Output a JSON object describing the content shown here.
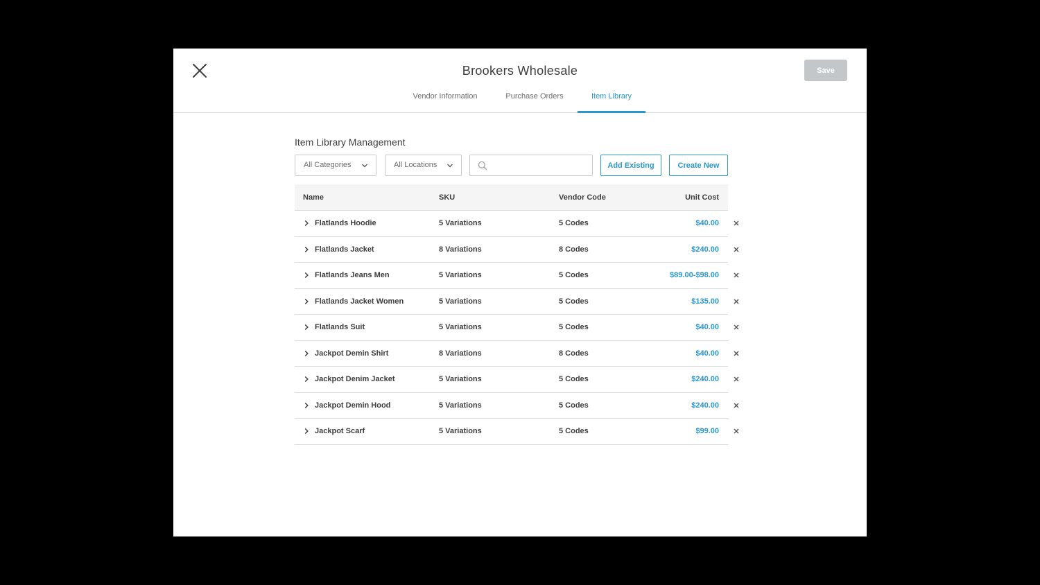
{
  "header": {
    "title": "Brookers Wholesale",
    "save_label": "Save"
  },
  "tabs": [
    {
      "label": "Vendor Information",
      "active": false
    },
    {
      "label": "Purchase Orders",
      "active": false
    },
    {
      "label": "Item Library",
      "active": true
    }
  ],
  "section": {
    "title": "Item Library Management"
  },
  "toolbar": {
    "categories_label": "All Categories",
    "locations_label": "All Locations",
    "search_value": "",
    "add_existing_label": "Add Existing",
    "create_new_label": "Create New"
  },
  "table": {
    "headers": {
      "name": "Name",
      "sku": "SKU",
      "vendor_code": "Vendor Code",
      "unit_cost": "Unit Cost"
    },
    "rows": [
      {
        "name": "Flatlands Hoodie",
        "sku": "5 Variations",
        "code": "5 Codes",
        "cost": "$40.00"
      },
      {
        "name": "Flatlands Jacket",
        "sku": "8 Variations",
        "code": "8 Codes",
        "cost": "$240.00"
      },
      {
        "name": "Flatlands Jeans Men",
        "sku": "5 Variations",
        "code": "5 Codes",
        "cost": "$89.00-$98.00"
      },
      {
        "name": "Flatlands Jacket Women",
        "sku": "5 Variations",
        "code": "5 Codes",
        "cost": "$135.00"
      },
      {
        "name": "Flatlands Suit",
        "sku": "5 Variations",
        "code": "5 Codes",
        "cost": "$40.00"
      },
      {
        "name": "Jackpot Demin Shirt",
        "sku": "8 Variations",
        "code": "8 Codes",
        "cost": "$40.00"
      },
      {
        "name": "Jackpot Denim Jacket",
        "sku": "5 Variations",
        "code": "5 Codes",
        "cost": "$240.00"
      },
      {
        "name": "Jackpot Demin Hood",
        "sku": "5 Variations",
        "code": "5 Codes",
        "cost": "$240.00"
      },
      {
        "name": "Jackpot Scarf",
        "sku": "5 Variations",
        "code": "5 Codes",
        "cost": "$99.00"
      }
    ]
  },
  "colors": {
    "accent": "#2996cc",
    "save_disabled": "#c4c7ca",
    "text": "#3d3d3d",
    "backdrop": "#000000"
  },
  "icons": {
    "close": "close-icon",
    "dropdown": "chevron-down-icon",
    "search": "search-icon",
    "expand": "chevron-right-icon",
    "remove": "remove-icon"
  }
}
